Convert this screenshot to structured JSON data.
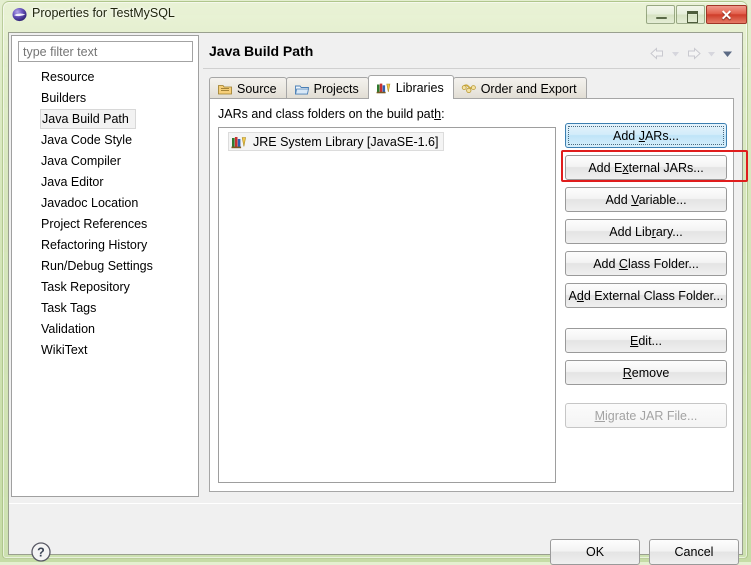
{
  "window": {
    "title": "Properties for TestMySQL",
    "icon": "eclipse-sphere-icon",
    "controls": {
      "minimize": "minimize-icon",
      "maximize": "maximize-icon",
      "close": "✕"
    }
  },
  "sidebar": {
    "filter": {
      "placeholder": "type filter text",
      "value": ""
    },
    "items": [
      {
        "label": "Resource",
        "selected": false
      },
      {
        "label": "Builders",
        "selected": false
      },
      {
        "label": "Java Build Path",
        "selected": true
      },
      {
        "label": "Java Code Style",
        "selected": false
      },
      {
        "label": "Java Compiler",
        "selected": false
      },
      {
        "label": "Java Editor",
        "selected": false
      },
      {
        "label": "Javadoc Location",
        "selected": false
      },
      {
        "label": "Project References",
        "selected": false
      },
      {
        "label": "Refactoring History",
        "selected": false
      },
      {
        "label": "Run/Debug Settings",
        "selected": false
      },
      {
        "label": "Task Repository",
        "selected": false
      },
      {
        "label": "Task Tags",
        "selected": false
      },
      {
        "label": "Validation",
        "selected": false
      },
      {
        "label": "WikiText",
        "selected": false
      }
    ]
  },
  "content": {
    "page_title": "Java Build Path",
    "nav": {
      "back": "back-arrow-icon",
      "back_menu": "chevron-down-icon",
      "forward": "forward-arrow-icon",
      "forward_menu": "chevron-down-icon",
      "more_menu": "chevron-down-icon"
    },
    "tabs": [
      {
        "label": "Source",
        "icon": "source-folder-icon",
        "active": false
      },
      {
        "label": "Projects",
        "icon": "projects-folder-icon",
        "active": false
      },
      {
        "label": "Libraries",
        "icon": "libraries-books-icon",
        "active": true
      },
      {
        "label": "Order and Export",
        "icon": "order-export-icon",
        "active": false
      }
    ],
    "list_label": "JARs and class folders on the build path:",
    "list_label_mnemonic": "h",
    "entries": [
      {
        "label": "JRE System Library [JavaSE-1.6]",
        "icon": "jre-library-icon",
        "selected": true
      }
    ],
    "actions": [
      {
        "label": "Add JARs...",
        "state": "focused",
        "mnemonic": "J"
      },
      {
        "label": "Add External JARs...",
        "state": "enabled",
        "mnemonic": "x"
      },
      {
        "label": "Add Variable...",
        "state": "enabled",
        "mnemonic": "V"
      },
      {
        "label": "Add Library...",
        "state": "enabled",
        "mnemonic": "r"
      },
      {
        "label": "Add Class Folder...",
        "state": "enabled",
        "mnemonic": "C"
      },
      {
        "label": "Add External Class Folder...",
        "state": "enabled",
        "mnemonic": "d"
      },
      {
        "label": "Edit...",
        "state": "enabled",
        "mnemonic": "E"
      },
      {
        "label": "Remove",
        "state": "enabled",
        "mnemonic": "R"
      },
      {
        "label": "Migrate JAR File...",
        "state": "disabled",
        "mnemonic": "M"
      }
    ]
  },
  "footer": {
    "help": "help-question-icon",
    "ok": "OK",
    "cancel": "Cancel"
  },
  "annotation": {
    "target": "Add JARs...",
    "color": "#e01d1d"
  },
  "colors": {
    "window_frame": "#cfe2b2",
    "focus_blue": "#3c7fb1",
    "annotation_red": "#e01d1d",
    "dialog_bg": "#f0f0f0"
  }
}
